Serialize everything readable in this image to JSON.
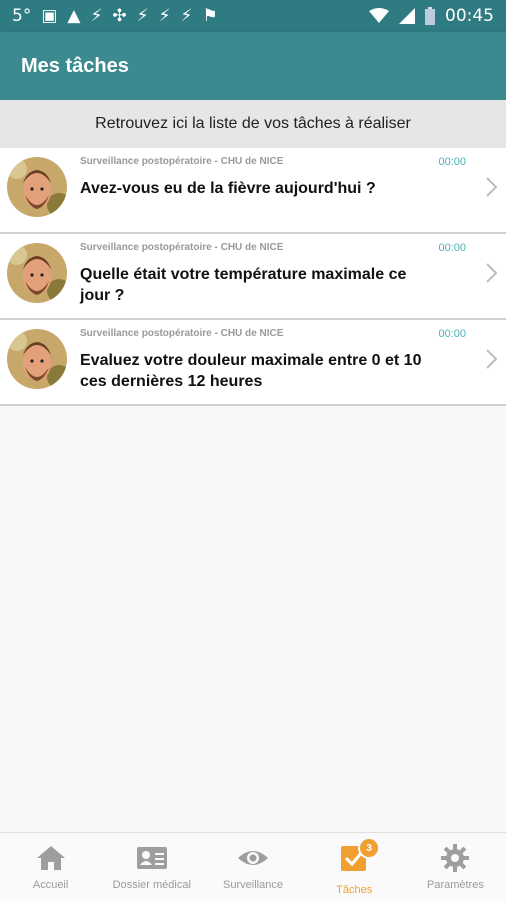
{
  "status_bar": {
    "temperature": "5°",
    "icons_left": [
      "image-icon",
      "warning-icon",
      "blocked-sync-icon",
      "sync-icon",
      "blocked-sync-icon",
      "blocked-sync-icon",
      "blocked-sync-icon",
      "flag-icon"
    ],
    "icons_right": [
      "wifi-icon",
      "signal-icon",
      "battery-icon"
    ],
    "time": "00:45"
  },
  "app_bar": {
    "title": "Mes tâches"
  },
  "subheader": {
    "text": "Retrouvez ici la liste de vos tâches à réaliser"
  },
  "tasks": [
    {
      "source": "Surveillance postopératoire - CHU de NICE",
      "time": "00:00",
      "question": "Avez-vous eu de la fièvre aujourd'hui ?"
    },
    {
      "source": "Surveillance postopératoire - CHU de NICE",
      "time": "00:00",
      "question": "Quelle était votre température maximale ce jour ?"
    },
    {
      "source": "Surveillance postopératoire - CHU de NICE",
      "time": "00:00",
      "question": "Evaluez votre douleur maximale entre 0 et 10 ces dernières 12 heures"
    }
  ],
  "bottom_nav": {
    "items": [
      {
        "label": "Accueil",
        "icon": "home-icon",
        "active": false
      },
      {
        "label": "Dossier médical",
        "icon": "id-card-icon",
        "active": false
      },
      {
        "label": "Surveillance",
        "icon": "eye-icon",
        "active": false
      },
      {
        "label": "Tâches",
        "icon": "checkbox-icon",
        "active": true,
        "badge": "3"
      },
      {
        "label": "Paramètres",
        "icon": "gear-icon",
        "active": false
      }
    ]
  },
  "colors": {
    "status_bar": "#2f7b82",
    "app_bar": "#3a8a8f",
    "accent_active": "#f0a030",
    "time_text": "#4ab2b8"
  }
}
